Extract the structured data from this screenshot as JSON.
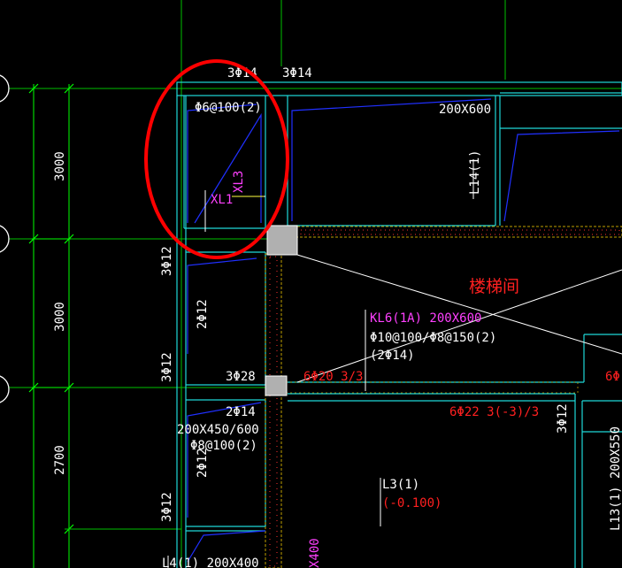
{
  "drawing": {
    "dimensions": [
      "3000",
      "3000",
      "2700"
    ],
    "top_rebar_left": "3Φ14",
    "top_rebar_right": "3Φ14",
    "xl1_stirrup": "Φ6@100(2)",
    "xl1_label": "XL1",
    "xl3_label": "XL3",
    "beam_size_top_right": "200X600",
    "l14_label": "L14(1)",
    "left_rebar_upper": "3Φ12",
    "left_rebar_middle": "3Φ12",
    "left_rebar_lower": "3Φ12",
    "mid_rebar_upper": "2Φ12",
    "mid_rebar_lower": "2Φ12",
    "stair_room": "楼梯间",
    "kl6_label": "KL6(1A) 200X600",
    "kl6_stirrup": "Φ10@100/Φ8@150(2)",
    "kl6_top": "(2Φ14)",
    "rebar_3c28": "3Φ28",
    "bottom_rebar_6c20": "6Φ20 3/3",
    "bottom_rebar_6c_partial": "6Φ",
    "rebar_2c14": "2Φ14",
    "beam_size_left": "200X450/600",
    "beam_stirrup_left": "Φ8@100(2)",
    "bottom_rebar_6c22": "6Φ22 3(-3)/3",
    "right_rebar": "3Φ12",
    "l3_label": "L3(1)",
    "l3_elev": "(-0.100)",
    "l13_label": "L13(1) 200X550",
    "bottom_left_label": "L4(1) 200X400",
    "bottom_vertical_label": "X400"
  },
  "colors": {
    "background": "#000000",
    "dimension": "#00ff00",
    "grid": "#00c000",
    "beam_outline": "#1fd8d8",
    "rebar_line": "#2030ff",
    "text_white": "#ffffff",
    "text_magenta": "#ff40ff",
    "text_red": "#ff2020",
    "text_yellow": "#ffff40",
    "highlight_circle": "#ff0000"
  }
}
